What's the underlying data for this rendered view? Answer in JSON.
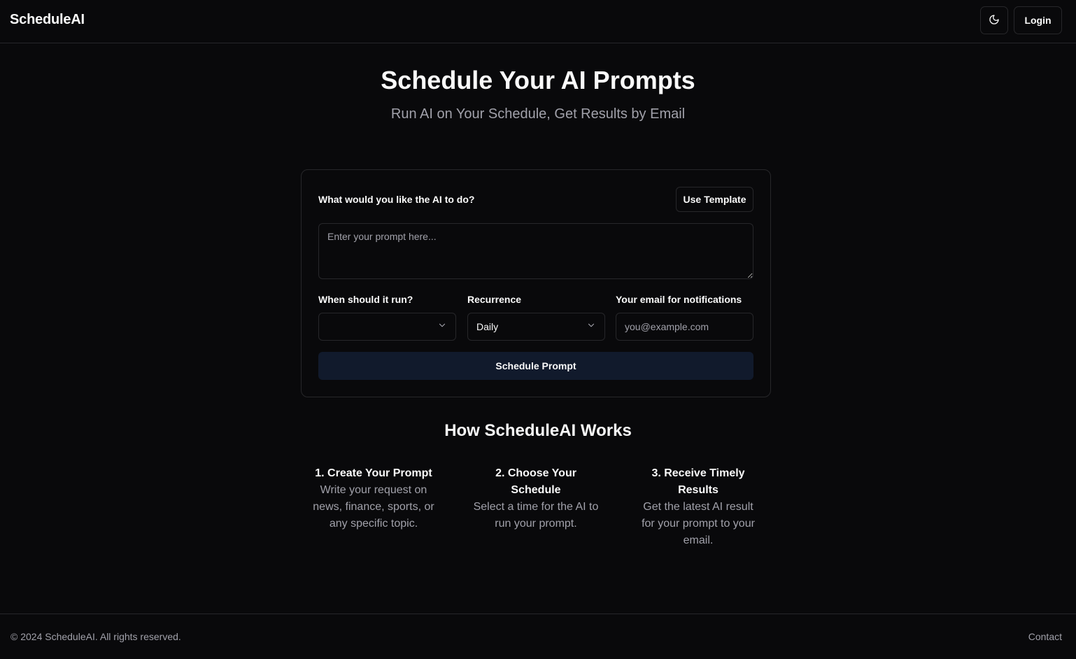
{
  "header": {
    "brand": "ScheduleAI",
    "theme_toggle_icon": "moon-icon",
    "login_label": "Login"
  },
  "hero": {
    "title": "Schedule Your AI Prompts",
    "subtitle": "Run AI on Your Schedule, Get Results by Email"
  },
  "form": {
    "prompt_label": "What would you like the AI to do?",
    "template_button": "Use Template",
    "prompt_placeholder": "Enter your prompt here...",
    "prompt_value": "",
    "when_label": "When should it run?",
    "when_value": "",
    "recurrence_label": "Recurrence",
    "recurrence_value": "Daily",
    "email_label": "Your email for notifications",
    "email_placeholder": "you@example.com",
    "email_value": "",
    "submit_label": "Schedule Prompt"
  },
  "how": {
    "title": "How ScheduleAI Works",
    "steps": [
      {
        "title": "1. Create Your Prompt",
        "text": "Write your request on news, finance, sports, or any specific topic."
      },
      {
        "title": "2. Choose Your Schedule",
        "text": "Select a time for the AI to run your prompt."
      },
      {
        "title": "3. Receive Timely Results",
        "text": "Get the latest AI result for your prompt to your email."
      }
    ]
  },
  "footer": {
    "copyright": "© 2024 ScheduleAI. All rights reserved.",
    "contact_label": "Contact"
  },
  "colors": {
    "background": "#09090b",
    "border": "#27272a",
    "muted_text": "#a1a1aa",
    "primary_button": "#111a2c"
  }
}
